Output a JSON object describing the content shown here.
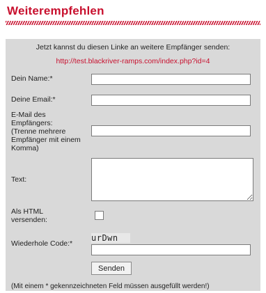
{
  "title": "Weiterempfehlen",
  "intro": "Jetzt kannst du diesen Linke an weitere Empfänger senden:",
  "link": "http://test.blackriver-ramps.com/index.php?id=4",
  "form": {
    "name_label": "Dein Name:*",
    "name_value": "",
    "email_label": "Deine Email:*",
    "email_value": "",
    "recipient_label_1": "E-Mail des",
    "recipient_label_2": "Empfängers:",
    "recipient_label_3": "(Trenne mehrere",
    "recipient_label_4": "Empfänger mit einem",
    "recipient_label_5": "Komma)",
    "recipient_value": "",
    "text_label": "Text:",
    "text_value": "",
    "html_label_1": "Als HTML",
    "html_label_2": "versenden:",
    "html_checked": false,
    "code_label": "Wiederhole Code:*",
    "captcha_text": "urDwn",
    "code_value": "",
    "submit_label": "Senden"
  },
  "footer_note": "(Mit einem * gekennzeichneten Feld müssen ausgefüllt werden!)",
  "colors": {
    "accent": "#c8102e",
    "panel": "#d9d9d9"
  }
}
